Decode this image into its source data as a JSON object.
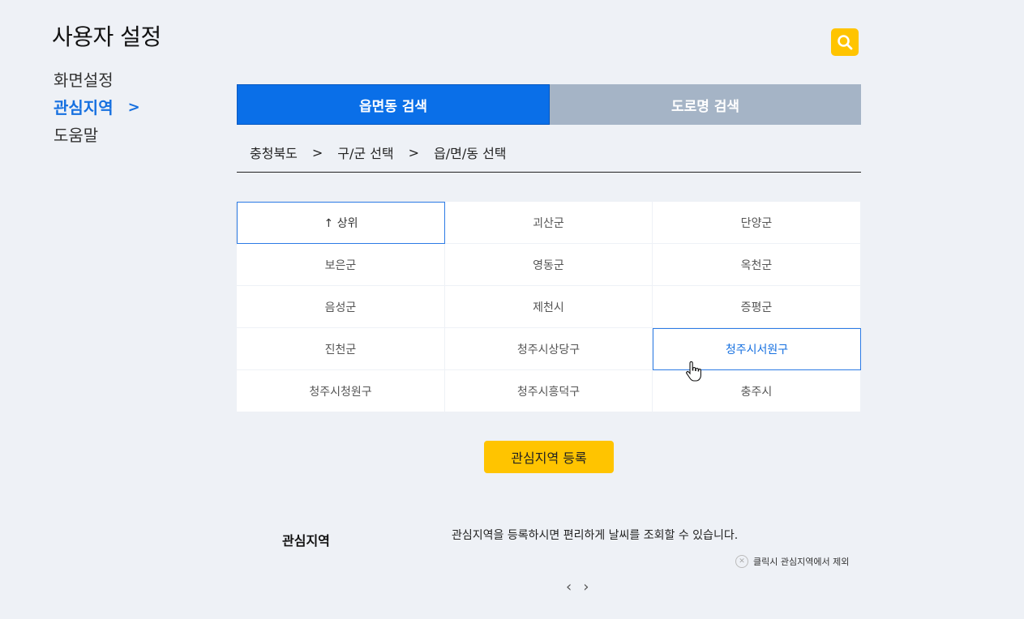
{
  "page": {
    "title": "사용자 설정"
  },
  "side_nav": {
    "items": [
      {
        "label": "화면설정"
      },
      {
        "label": "관심지역",
        "active_marker": ">"
      },
      {
        "label": "도움말"
      }
    ]
  },
  "tabs": [
    {
      "label": "읍면동 검색"
    },
    {
      "label": "도로명 검색"
    }
  ],
  "breadcrumb": {
    "items": [
      "충청북도",
      "구/군 선택",
      "읍/면/동 선택"
    ],
    "separator": ">"
  },
  "region_grid": {
    "cells": [
      "↑ 상위",
      "괴산군",
      "단양군",
      "보은군",
      "영동군",
      "옥천군",
      "음성군",
      "제천시",
      "증평군",
      "진천군",
      "청주시상당구",
      "청주시서원구",
      "청주시청원구",
      "청주시흥덕구",
      "충주시"
    ]
  },
  "register_button": {
    "label": "관심지역 등록"
  },
  "favorites": {
    "label": "관심지역",
    "description": "관심지역을 등록하시면 편리하게 날씨를 조회할 수 있습니다.",
    "remove_hint": "클릭시 관심지역에서 제외"
  },
  "pager": {
    "prev": "‹",
    "next": "›"
  },
  "colors": {
    "accent_blue": "#0a6fe8",
    "accent_yellow": "#ffc400",
    "tab_inactive": "#a5b4c6",
    "background": "#eef1f6"
  }
}
